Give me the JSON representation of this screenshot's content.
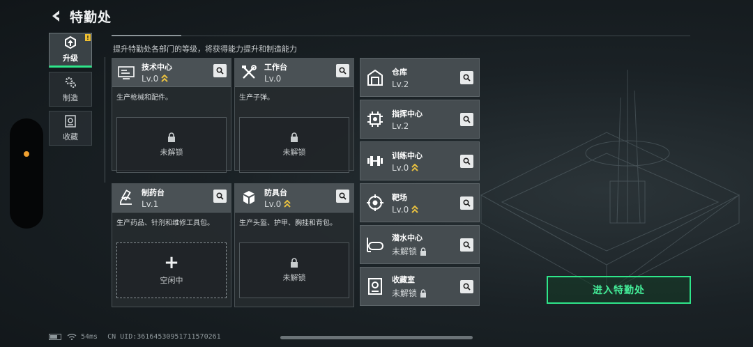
{
  "header": {
    "title": "特勤处"
  },
  "subtitle": "提升特勤处各部门的等级，将获得能力提升和制造能力",
  "tabs": [
    {
      "label": "升级",
      "icon": "upgrade-icon",
      "active": true,
      "badge": "!"
    },
    {
      "label": "制造",
      "icon": "gears-icon",
      "active": false
    },
    {
      "label": "收藏",
      "icon": "collection-icon",
      "active": false
    }
  ],
  "cards": [
    {
      "name": "技术中心",
      "level": "Lv.0",
      "upgradable": true,
      "desc": "生产枪械和配件。",
      "slot": "未解锁",
      "icon": "tech-center-icon"
    },
    {
      "name": "工作台",
      "level": "Lv.0",
      "upgradable": false,
      "desc": "生产子弹。",
      "slot": "未解锁",
      "icon": "workbench-icon"
    },
    {
      "name": "制药台",
      "level": "Lv.1",
      "upgradable": false,
      "desc": "生产药品、针剂和维修工具包。",
      "slot": "空闲中",
      "icon": "pharmacy-icon"
    },
    {
      "name": "防具台",
      "level": "Lv.0",
      "upgradable": true,
      "desc": "生产头盔、护甲、胸挂和背包。",
      "slot": "未解锁",
      "icon": "armor-bench-icon"
    }
  ],
  "facilities": [
    {
      "name": "仓库",
      "level": "Lv.2",
      "status": "level",
      "icon": "warehouse-icon"
    },
    {
      "name": "指挥中心",
      "level": "Lv.2",
      "status": "level",
      "icon": "command-center-icon"
    },
    {
      "name": "训练中心",
      "level": "Lv.0",
      "status": "upgradable",
      "icon": "training-icon"
    },
    {
      "name": "靶场",
      "level": "Lv.0",
      "status": "upgradable",
      "icon": "shooting-range-icon"
    },
    {
      "name": "潜水中心",
      "level": "未解锁",
      "status": "locked",
      "icon": "diving-icon"
    },
    {
      "name": "收藏室",
      "level": "未解锁",
      "status": "locked",
      "icon": "collection-room-icon"
    }
  ],
  "enter_button": "进入特勤处",
  "status_bar": {
    "ping": "54ms",
    "uid": "CN UID:361645309517115702​61"
  },
  "colors": {
    "accent": "#2ee68a",
    "upgrade_arrow": "#e8c040",
    "badge": "#f0c030"
  }
}
